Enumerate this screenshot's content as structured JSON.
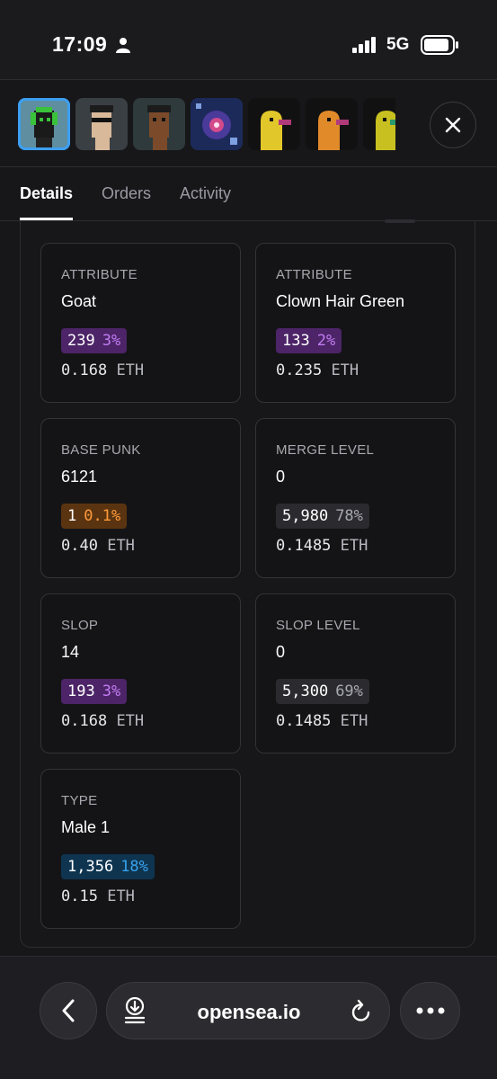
{
  "status_bar": {
    "time": "17:09",
    "network": "5G"
  },
  "tabs": [
    {
      "label": "Details",
      "active": true
    },
    {
      "label": "Orders",
      "active": false
    },
    {
      "label": "Activity",
      "active": false
    }
  ],
  "thumbnails": [
    {
      "name": "punk-green-headphones",
      "active": true
    },
    {
      "name": "punk-sunglasses",
      "active": false
    },
    {
      "name": "punk-dark",
      "active": false
    },
    {
      "name": "cosmic-art",
      "active": false
    },
    {
      "name": "yellow-creature-1",
      "active": false
    },
    {
      "name": "orange-creature",
      "active": false
    },
    {
      "name": "yellow-creature-2",
      "active": false
    }
  ],
  "traits": [
    {
      "key": "ATTRIBUTE",
      "value": "Goat",
      "count": "239",
      "pct": "3%",
      "color": "purple",
      "price": "0.168",
      "unit": "ETH"
    },
    {
      "key": "ATTRIBUTE",
      "value": "Clown Hair Green",
      "count": "133",
      "pct": "2%",
      "color": "purple",
      "price": "0.235",
      "unit": "ETH"
    },
    {
      "key": "BASE PUNK",
      "value": "6121",
      "count": "1",
      "pct": "0.1%",
      "color": "orange",
      "price": "0.40",
      "unit": "ETH"
    },
    {
      "key": "MERGE LEVEL",
      "value": "0",
      "count": "5,980",
      "pct": "78%",
      "color": "grey",
      "price": "0.1485",
      "unit": "ETH"
    },
    {
      "key": "SLOP",
      "value": "14",
      "count": "193",
      "pct": "3%",
      "color": "purple",
      "price": "0.168",
      "unit": "ETH"
    },
    {
      "key": "SLOP LEVEL",
      "value": "0",
      "count": "5,300",
      "pct": "69%",
      "color": "grey",
      "price": "0.1485",
      "unit": "ETH"
    },
    {
      "key": "TYPE",
      "value": "Male 1",
      "count": "1,356",
      "pct": "18%",
      "color": "blue",
      "price": "0.15",
      "unit": "ETH"
    }
  ],
  "browser": {
    "url": "opensea.io"
  }
}
